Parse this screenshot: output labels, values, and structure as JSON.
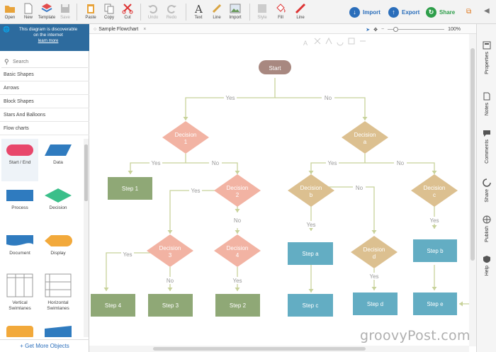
{
  "toolbar": {
    "open": "Open",
    "new": "New",
    "template": "Template",
    "save": "Save",
    "paste": "Paste",
    "copy": "Copy",
    "cut": "Cut",
    "undo": "Undo",
    "redo": "Redo",
    "text": "Text",
    "line": "Line",
    "import": "Import",
    "style": "Style",
    "fill": "Fill",
    "line2": "Line",
    "import_btn": "Import",
    "export_btn": "Export",
    "share_btn": "Share",
    "colors": {
      "import": "#2a6ebb",
      "export": "#2a6ebb",
      "share": "#2e9e4a"
    }
  },
  "promo": {
    "line1": "This diagram is discoverable",
    "line2": "on the internet",
    "link": "learn more"
  },
  "search": {
    "placeholder": "Search"
  },
  "categories": [
    "Basic Shapes",
    "Arrows",
    "Block Shapes",
    "Stars And Balloons",
    "Flow charts"
  ],
  "shapes": [
    "Start / End",
    "Data",
    "Process",
    "Decision",
    "Document",
    "Display",
    "Vertical Swimlanes",
    "Horizontal Swimlanes"
  ],
  "more_objects": "+ Get More Objects",
  "tab": {
    "title": "Sample Flowchart",
    "close": "×"
  },
  "zoom": {
    "level": "100%"
  },
  "right_panel": [
    "Properties",
    "Notes",
    "Comments",
    "Share",
    "Publish",
    "Help"
  ],
  "flowchart": {
    "start": "Start",
    "yes": "Yes",
    "no": "No",
    "decision1": "Decision 1",
    "decisiona": "Decision a",
    "decision2": "Decision 2",
    "decisionb": "Decision b",
    "decisionc": "Decision c",
    "decision3": "Decision 3",
    "decision4": "Decision 4",
    "decisiond": "Decision d",
    "step1": "Step 1",
    "step2": "Step 2",
    "step3": "Step 3",
    "step4": "Step 4",
    "stepa": "Step a",
    "stepb": "Step b",
    "stepc": "Step c",
    "stepd": "Step d",
    "stepe": "Step e",
    "colors": {
      "start": "#a88880",
      "pink": "#f2b3a3",
      "tan": "#dcc090",
      "green": "#8fa876",
      "teal": "#63adc3",
      "connector": "#c8d29a",
      "label": "#999999"
    }
  },
  "watermark": "groovyPost.com"
}
